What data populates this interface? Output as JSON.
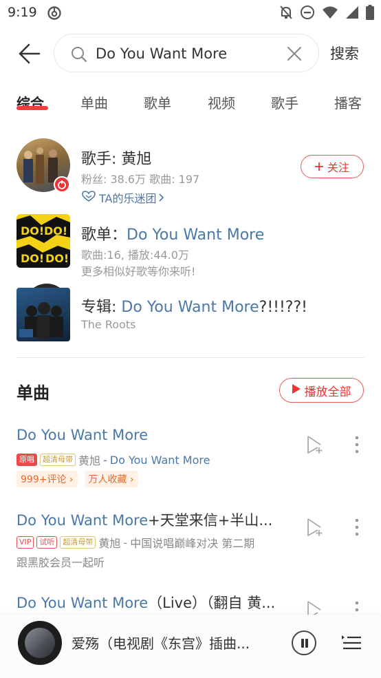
{
  "status_bar": {
    "time": "9:19"
  },
  "search": {
    "query": "Do You Want More",
    "search_button": "搜索"
  },
  "tabs": [
    "综合",
    "单曲",
    "歌单",
    "视频",
    "歌手",
    "播客"
  ],
  "artist_result": {
    "title_prefix": "歌手: ",
    "name": "黄旭",
    "stats": "粉丝: 38.6万 歌曲: 197",
    "fan_group": "TA的乐迷团",
    "follow_label": "关注"
  },
  "playlist_result": {
    "title_prefix": "歌单：",
    "name": "Do You Want More",
    "stats": "歌曲:16, 播放:44.0万",
    "desc": "更多相似好歌等你来听!"
  },
  "album_result": {
    "title_prefix": "专辑: ",
    "name_highlight": "Do You Want More",
    "name_rest": "?!!!??!",
    "artist": "The Roots"
  },
  "songs_section": {
    "title": "单曲",
    "play_all": "播放全部"
  },
  "songs": [
    {
      "title_highlight": "Do You Want More",
      "title_rest": "",
      "tags": [
        "原唱",
        "超清母带"
      ],
      "artist": "黄旭",
      "separator": " - ",
      "album": "Do You Want More",
      "pills": [
        "999+评论",
        "万人收藏"
      ]
    },
    {
      "title_highlight": "Do You Want More",
      "title_rest": "+天堂来信+半山...",
      "tags": [
        "VIP",
        "试听",
        "超清母带"
      ],
      "artist": "黄旭",
      "separator": " - ",
      "album": "中国说唱巅峰对决 第二期",
      "extra": "跟黑胶会员一起听"
    },
    {
      "title_highlight": "Do You Want More",
      "title_rest": "（Live）（翻自 黄..."
    }
  ],
  "player": {
    "now_playing": "爱殇（电视剧《东宫》插曲..."
  },
  "colors": {
    "accent_red": "#e33333",
    "highlight_blue": "#4a78a8"
  }
}
